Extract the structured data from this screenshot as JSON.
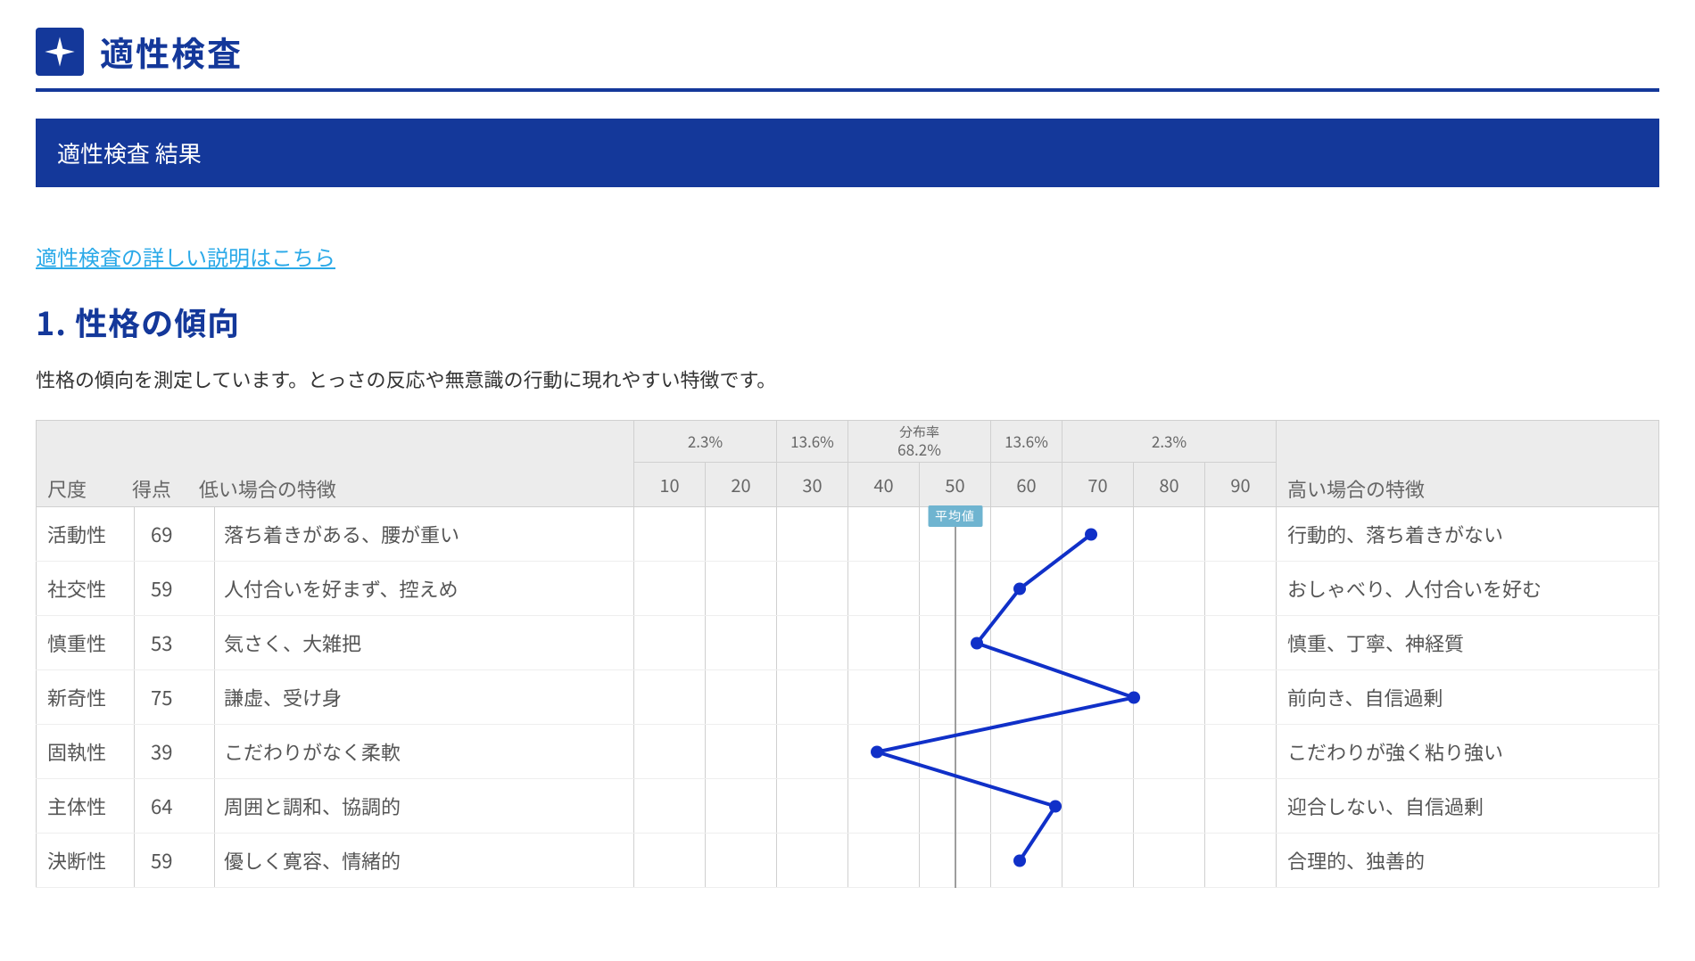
{
  "header": {
    "app_title": "適性検査"
  },
  "result_bar": "適性検査 結果",
  "detail_link": "適性検査の詳しい説明はこちら",
  "section": {
    "number_title": "1. 性格の傾向",
    "description": "性格の傾向を測定しています。とっさの反応や無意識の行動に現れやすい特徴です。"
  },
  "table": {
    "headers": {
      "scale": "尺度",
      "score": "得点",
      "low": "低い場合の特徴",
      "high": "高い場合の特徴",
      "distribution_label": "分布率",
      "avg_label": "平均値"
    },
    "distribution": [
      {
        "pct": "2.3%",
        "span": 2
      },
      {
        "pct": "13.6%",
        "span": 1
      },
      {
        "pct": "68.2%",
        "span": 2,
        "top_label": true
      },
      {
        "pct": "13.6%",
        "span": 1
      },
      {
        "pct": "2.3%",
        "span": 3
      }
    ],
    "ticks": [
      10,
      20,
      30,
      40,
      50,
      60,
      70,
      80,
      90
    ],
    "rows": [
      {
        "scale": "活動性",
        "score": 69,
        "low": "落ち着きがある、腰が重い",
        "high": "行動的、落ち着きがない"
      },
      {
        "scale": "社交性",
        "score": 59,
        "low": "人付合いを好まず、控えめ",
        "high": "おしゃべり、人付合いを好む"
      },
      {
        "scale": "慎重性",
        "score": 53,
        "low": "気さく、大雑把",
        "high": "慎重、丁寧、神経質"
      },
      {
        "scale": "新奇性",
        "score": 75,
        "low": "謙虚、受け身",
        "high": "前向き、自信過剰"
      },
      {
        "scale": "固執性",
        "score": 39,
        "low": "こだわりがなく柔軟",
        "high": "こだわりが強く粘り強い"
      },
      {
        "scale": "主体性",
        "score": 64,
        "low": "周囲と調和、協調的",
        "high": "迎合しない、自信過剰"
      },
      {
        "scale": "決断性",
        "score": 59,
        "low": "優しく寛容、情緒的",
        "high": "合理的、独善的"
      }
    ]
  },
  "chart_data": {
    "type": "line",
    "title": "性格の傾向",
    "xlabel": "得点",
    "ylabel": "尺度",
    "xlim": [
      5,
      95
    ],
    "x_ticks": [
      10,
      20,
      30,
      40,
      50,
      60,
      70,
      80,
      90
    ],
    "average": 50,
    "categories": [
      "活動性",
      "社交性",
      "慎重性",
      "新奇性",
      "固執性",
      "主体性",
      "決断性"
    ],
    "values": [
      69,
      59,
      53,
      75,
      39,
      64,
      59
    ]
  }
}
